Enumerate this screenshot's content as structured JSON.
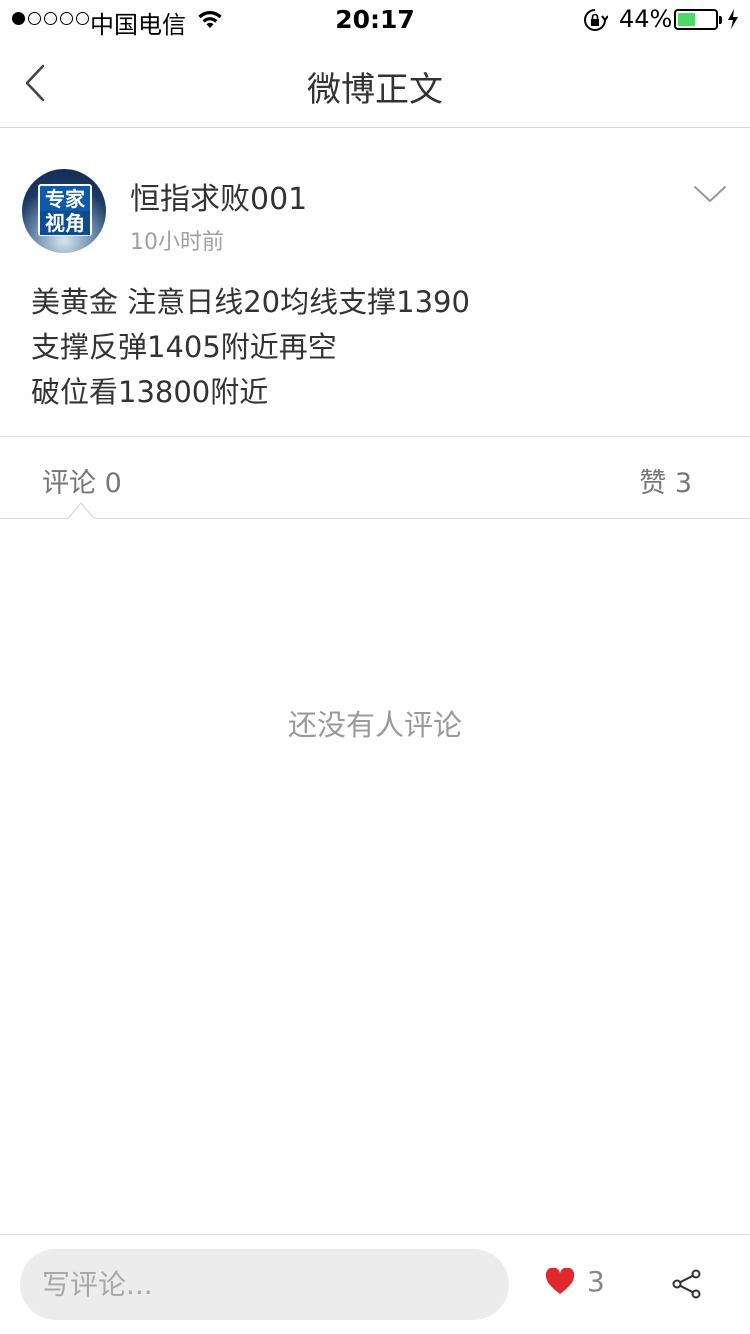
{
  "status_bar": {
    "carrier": "中国电信",
    "time": "20:17",
    "battery_percent": "44%",
    "battery_level": 0.44,
    "signal_bars_filled": 1,
    "signal_bars_total": 5,
    "battery_color": "#4cd964"
  },
  "nav": {
    "title": "微博正文",
    "back_icon": "chevron-left-icon"
  },
  "post": {
    "author": "恒指求败001",
    "time_ago": "10小时前",
    "avatar_text_line1": "专家",
    "avatar_text_line2": "视角",
    "menu_icon": "chevron-down-icon",
    "lines": [
      "美黄金 注意日线20均线支撑1390",
      "支撑反弹1405附近再空",
      "破位看13800附近"
    ]
  },
  "tabs": {
    "comments_label": "评论",
    "comments_count": "0",
    "likes_label": "赞",
    "likes_count": "3",
    "active": "comments"
  },
  "empty_state": {
    "text": "还没有人评论"
  },
  "bottom_bar": {
    "comment_placeholder": "写评论...",
    "like_count": "3",
    "like_icon": "heart-icon",
    "share_icon": "share-icon",
    "heart_color": "#e0282e"
  }
}
